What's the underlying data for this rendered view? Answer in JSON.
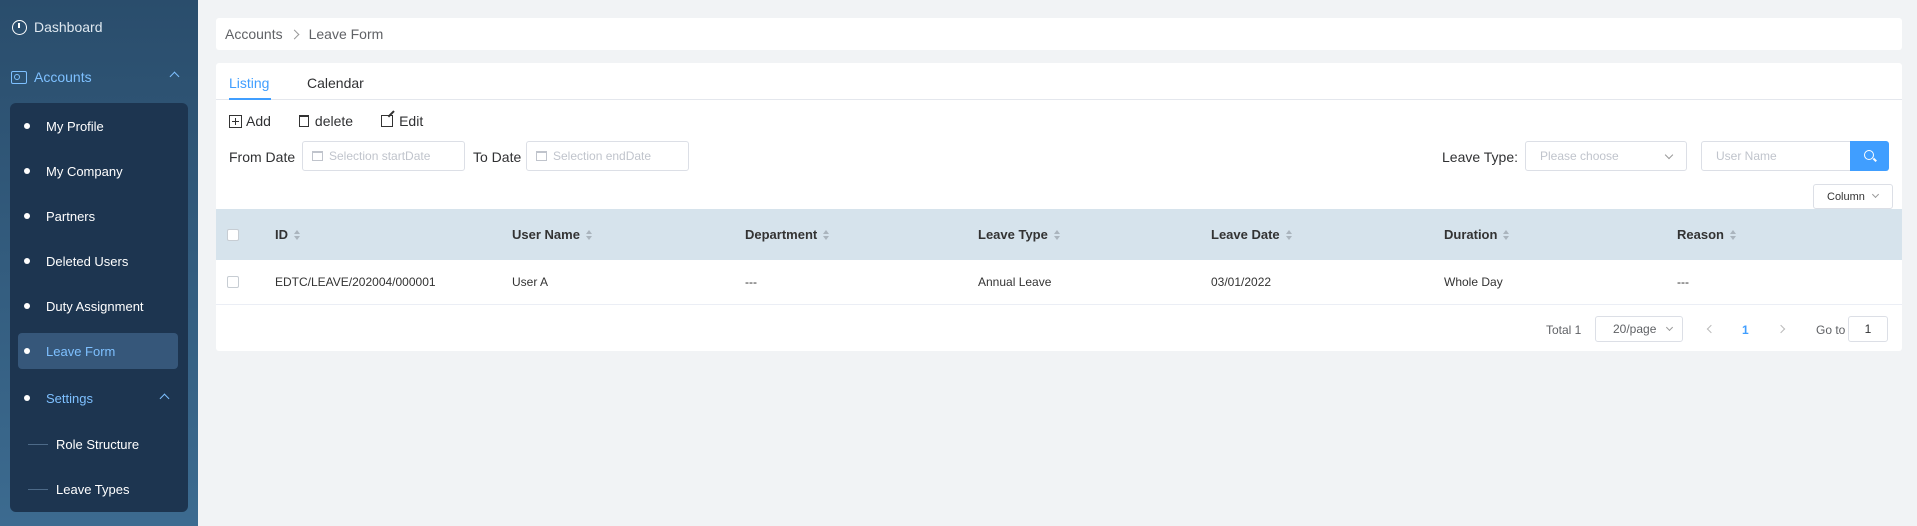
{
  "sidebar": {
    "dashboard": "Dashboard",
    "accounts": "Accounts",
    "items": [
      {
        "label": "My Profile"
      },
      {
        "label": "My Company"
      },
      {
        "label": "Partners"
      },
      {
        "label": "Deleted Users"
      },
      {
        "label": "Duty Assignment"
      },
      {
        "label": "Leave Form"
      }
    ],
    "settings": "Settings",
    "settings_items": [
      {
        "label": "Role Structure"
      },
      {
        "label": "Leave Types"
      }
    ],
    "accent_color": "#7ec0ff"
  },
  "breadcrumb": {
    "root": "Accounts",
    "current": "Leave Form"
  },
  "tabs": [
    {
      "label": "Listing"
    },
    {
      "label": "Calendar"
    }
  ],
  "toolbar": {
    "add": "Add",
    "delete": "delete",
    "edit": "Edit"
  },
  "filters": {
    "from_label": "From Date",
    "from_placeholder": "Selection startDate",
    "to_label": "To Date",
    "to_placeholder": "Selection endDate",
    "leave_type_label": "Leave Type:",
    "leave_type_placeholder": "Please choose",
    "user_placeholder": "User Name"
  },
  "column_button": "Column",
  "table": {
    "headers": [
      "ID",
      "User Name",
      "Department",
      "Leave Type",
      "Leave Date",
      "Duration",
      "Reason"
    ],
    "rows": [
      [
        "EDTC/LEAVE/202004/000001",
        "User A",
        "---",
        "Annual Leave",
        "03/01/2022",
        "Whole Day",
        "---"
      ]
    ]
  },
  "pagination": {
    "total": "Total 1",
    "page_size": "20/page",
    "current_page": "1",
    "goto_label": "Go to",
    "goto_value": "1"
  },
  "colors": {
    "primary": "#409eff",
    "header_bg": "#d6e3ec"
  }
}
